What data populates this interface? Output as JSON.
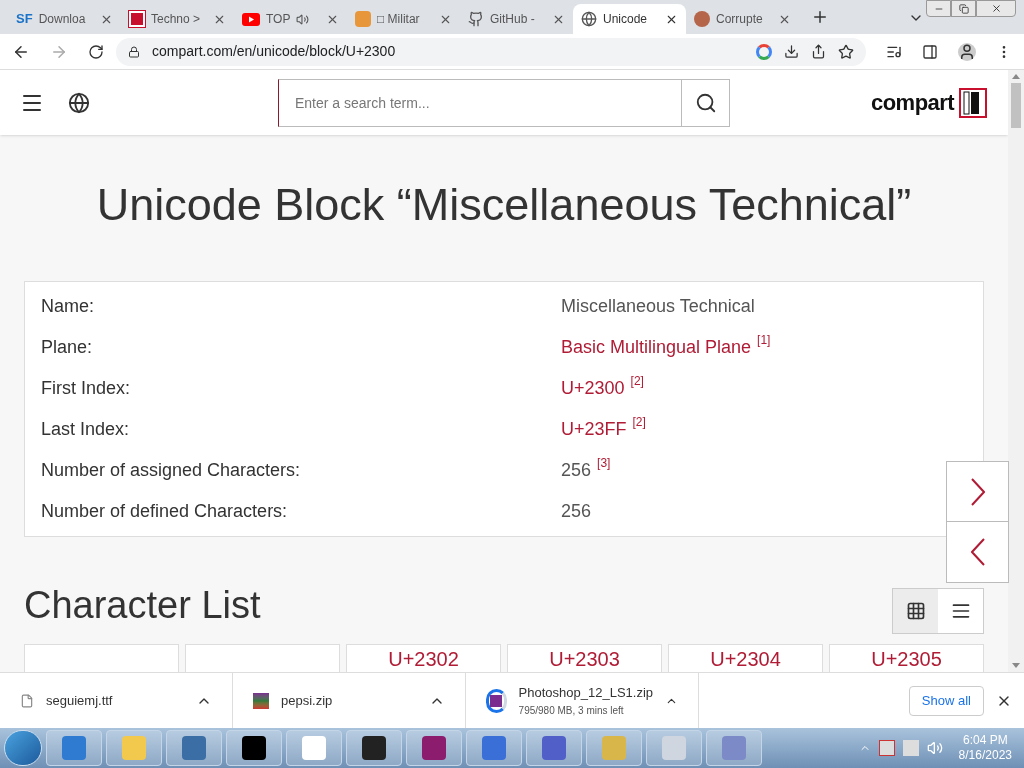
{
  "tabs": [
    {
      "title": "Downloa",
      "icon_text": "SF",
      "selected": false,
      "audio": false
    },
    {
      "title": "Techno >",
      "selected": false,
      "audio": false
    },
    {
      "title": "TOP",
      "selected": false,
      "audio": true
    },
    {
      "title": "□ Militar",
      "selected": false,
      "audio": false
    },
    {
      "title": "GitHub -",
      "selected": false,
      "audio": false
    },
    {
      "title": "Unicode",
      "selected": true,
      "audio": false
    },
    {
      "title": "Corrupte",
      "selected": false,
      "audio": false
    }
  ],
  "address": "compart.com/en/unicode/block/U+2300",
  "search": {
    "placeholder": "Enter a search term..."
  },
  "logo": "compart",
  "page_title": "Unicode Block “Miscellaneous Technical”",
  "properties": [
    {
      "label": "Name:",
      "value": "Miscellaneous Technical",
      "kind": "plain"
    },
    {
      "label": "Plane:",
      "value": "Basic Multilingual Plane",
      "kind": "link",
      "note": "[1]"
    },
    {
      "label": "First Index:",
      "value": "U+2300",
      "kind": "link",
      "note": "[2]"
    },
    {
      "label": "Last Index:",
      "value": "U+23FF",
      "kind": "link",
      "note": "[2]"
    },
    {
      "label": "Number of assigned Characters:",
      "value": "256",
      "kind": "plain",
      "note": "[3]"
    },
    {
      "label": "Number of defined Characters:",
      "value": "256",
      "kind": "plain"
    }
  ],
  "section_title": "Character List",
  "view_modes": [
    {
      "kind": "grid",
      "selected": true
    },
    {
      "kind": "list",
      "selected": false
    }
  ],
  "characters": [
    {
      "kind": "blank"
    },
    {
      "kind": "blank"
    },
    {
      "kind": "code",
      "label": "U+2302"
    },
    {
      "kind": "code",
      "label": "U+2303"
    },
    {
      "kind": "code",
      "label": "U+2304"
    },
    {
      "kind": "code",
      "label": "U+2305"
    }
  ],
  "downloads": [
    {
      "name": "seguiemj.ttf"
    },
    {
      "name": "pepsi.zip"
    },
    {
      "name": "Photoshop_12_LS1.zip",
      "status": "795/980 MB, 3 mins left"
    }
  ],
  "show_all": "Show all",
  "clock": {
    "time": "6:04 PM",
    "date": "8/16/2023"
  }
}
